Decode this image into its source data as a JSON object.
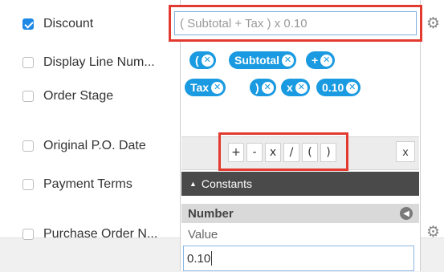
{
  "fields": [
    {
      "label": "Discount",
      "checked": true
    },
    {
      "label": "Display Line Num...",
      "checked": false
    },
    {
      "label": "Order Stage",
      "checked": false
    },
    {
      "label": "Original P.O. Date",
      "checked": false
    },
    {
      "label": "Payment Terms",
      "checked": false
    },
    {
      "label": "Purchase Order N...",
      "checked": false
    }
  ],
  "formula": {
    "expression": "( Subtotal + Tax ) x 0.10",
    "tokens": [
      "(",
      "Subtotal",
      "+",
      "Tax",
      ")",
      "x",
      "0.10"
    ],
    "remove_glyph": "⊗",
    "operators": [
      "+",
      "-",
      "x",
      "/",
      "(",
      ")"
    ],
    "clear_label": "x"
  },
  "constants": {
    "header": "Constants",
    "number_label": "Number",
    "value_label": "Value",
    "value": "0.10"
  },
  "colors": {
    "accent": "#1a9ae0",
    "highlight": "#e23a2e",
    "header_bg": "#4a4a4a"
  },
  "icons": {
    "gear": "gear-icon",
    "back": "back-arrow-icon",
    "collapse": "triangle-up-icon"
  }
}
